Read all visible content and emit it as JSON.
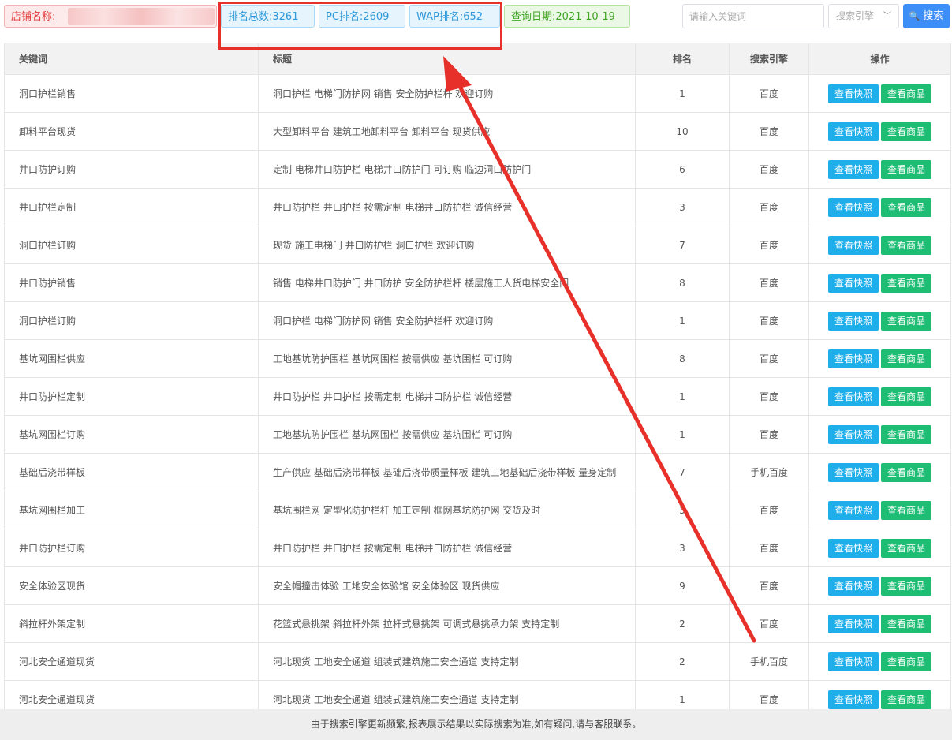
{
  "header": {
    "shop_label": "店铺名称:",
    "total_rank": "排名总数:3261",
    "pc_rank": "PC排名:2609",
    "wap_rank": "WAP排名:652",
    "query_date": "查询日期:2021-10-19"
  },
  "search": {
    "placeholder": "请输入关键词",
    "engine_placeholder": "搜索引擎",
    "button_label": "搜索"
  },
  "table": {
    "columns": {
      "keyword": "关键词",
      "title": "标题",
      "rank": "排名",
      "engine": "搜索引擎",
      "actions": "操作"
    },
    "snapshot_label": "查看快照",
    "goods_label": "查看商品",
    "rows": [
      {
        "keyword": "洞口护栏销售",
        "title": "洞口护栏 电梯门防护网 销售 安全防护栏杆 欢迎订购",
        "rank": "1",
        "engine": "百度"
      },
      {
        "keyword": "卸料平台现货",
        "title": "大型卸料平台 建筑工地卸料平台 卸料平台 现货供应",
        "rank": "10",
        "engine": "百度"
      },
      {
        "keyword": "井口防护订购",
        "title": "定制 电梯井口防护栏 电梯井口防护门 可订购 临边洞口防护门",
        "rank": "6",
        "engine": "百度"
      },
      {
        "keyword": "井口护栏定制",
        "title": "井口防护栏 井口护栏 按需定制 电梯井口防护栏 诚信经营",
        "rank": "3",
        "engine": "百度"
      },
      {
        "keyword": "洞口护栏订购",
        "title": "现货 施工电梯门 井口防护栏 洞口护栏 欢迎订购",
        "rank": "7",
        "engine": "百度"
      },
      {
        "keyword": "井口防护销售",
        "title": "销售 电梯井口防护门 井口防护 安全防护栏杆 楼层施工人货电梯安全门",
        "rank": "8",
        "engine": "百度"
      },
      {
        "keyword": "洞口护栏订购",
        "title": "洞口护栏 电梯门防护网 销售 安全防护栏杆 欢迎订购",
        "rank": "1",
        "engine": "百度"
      },
      {
        "keyword": "基坑网围栏供应",
        "title": "工地基坑防护围栏 基坑网围栏 按需供应 基坑围栏 可订购",
        "rank": "8",
        "engine": "百度"
      },
      {
        "keyword": "井口防护栏定制",
        "title": "井口防护栏 井口护栏 按需定制 电梯井口防护栏 诚信经营",
        "rank": "1",
        "engine": "百度"
      },
      {
        "keyword": "基坑网围栏订购",
        "title": "工地基坑防护围栏 基坑网围栏 按需供应 基坑围栏 可订购",
        "rank": "1",
        "engine": "百度"
      },
      {
        "keyword": "基础后浇带样板",
        "title": "生产供应 基础后浇带样板 基础后浇带质量样板 建筑工地基础后浇带样板 量身定制",
        "rank": "7",
        "engine": "手机百度"
      },
      {
        "keyword": "基坑网围栏加工",
        "title": "基坑围栏网 定型化防护栏杆 加工定制 框网基坑防护网 交货及时",
        "rank": "3",
        "engine": "百度"
      },
      {
        "keyword": "井口防护栏订购",
        "title": "井口防护栏 井口护栏 按需定制 电梯井口防护栏 诚信经营",
        "rank": "3",
        "engine": "百度"
      },
      {
        "keyword": "安全体验区现货",
        "title": "安全帽撞击体验 工地安全体验馆 安全体验区 现货供应",
        "rank": "9",
        "engine": "百度"
      },
      {
        "keyword": "斜拉杆外架定制",
        "title": "花篮式悬挑架 斜拉杆外架 拉杆式悬挑架 可调式悬挑承力架 支持定制",
        "rank": "2",
        "engine": "百度"
      },
      {
        "keyword": "河北安全通道现货",
        "title": "河北现货 工地安全通道 组装式建筑施工安全通道 支持定制",
        "rank": "2",
        "engine": "手机百度"
      },
      {
        "keyword": "河北安全通道现货",
        "title": "河北现货 工地安全通道 组装式建筑施工安全通道 支持定制",
        "rank": "1",
        "engine": "百度"
      }
    ]
  },
  "footer": {
    "notice": "由于搜索引擎更新频繁,报表展示结果以实际搜索为准,如有疑问,请与客服联系。"
  },
  "annotation": {
    "color": "#e8302a",
    "icon": "arrow-icon"
  }
}
